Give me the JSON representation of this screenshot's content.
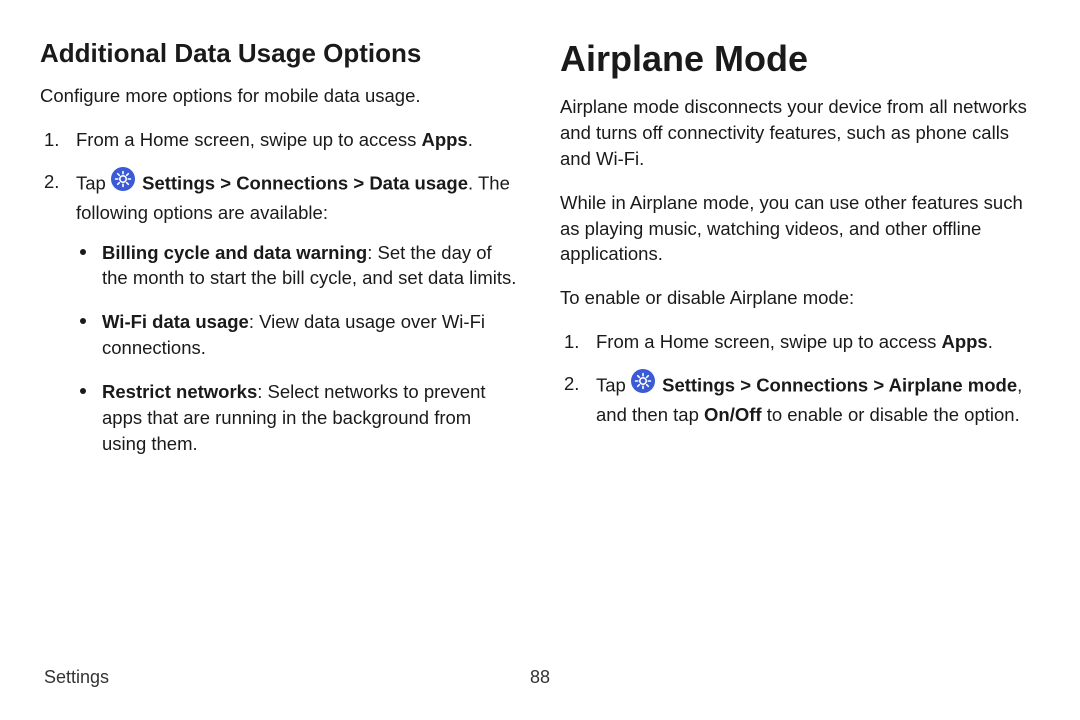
{
  "left": {
    "heading": "Additional Data Usage Options",
    "intro": "Configure more options for mobile data usage.",
    "steps": [
      {
        "prefix": "From a Home screen, swipe up to access ",
        "bold1": "Apps",
        "suffix": "."
      },
      {
        "prefix": "Tap ",
        "icon": "settings-gear-icon",
        "bold1": "Settings",
        "sep1": " > ",
        "bold2": "Connections",
        "sep2": " > ",
        "bold3": "Data usage",
        "suffix": ". The following options are available:",
        "bullets": [
          {
            "title": "Billing cycle and data warning",
            "desc": ": Set the day of the month to start the bill cycle, and set data limits."
          },
          {
            "title": "Wi-Fi data usage",
            "desc": ": View data usage over Wi-Fi connections."
          },
          {
            "title": "Restrict networks",
            "desc": ": Select networks to prevent apps that are running in the background from using them."
          }
        ]
      }
    ]
  },
  "right": {
    "heading": "Airplane Mode",
    "paras": [
      "Airplane mode disconnects your device from all networks and turns off connectivity features, such as phone calls and Wi-Fi.",
      "While in Airplane mode, you can use other features such as playing music, watching videos, and other offline applications.",
      "To enable or disable Airplane mode:"
    ],
    "steps": [
      {
        "prefix": "From a Home screen, swipe up to access ",
        "bold1": "Apps",
        "suffix": "."
      },
      {
        "prefix": "Tap ",
        "icon": "settings-gear-icon",
        "bold1": "Settings",
        "sep1": " > ",
        "bold2": "Connections",
        "sep2": " > ",
        "bold3": "Airplane mode",
        "mid": ", and then tap ",
        "bold4": "On/Off",
        "suffix": " to enable or disable the option."
      }
    ]
  },
  "footer": {
    "section": "Settings",
    "page": "88"
  },
  "icons": {
    "settings_color": "#3b5ad6"
  }
}
